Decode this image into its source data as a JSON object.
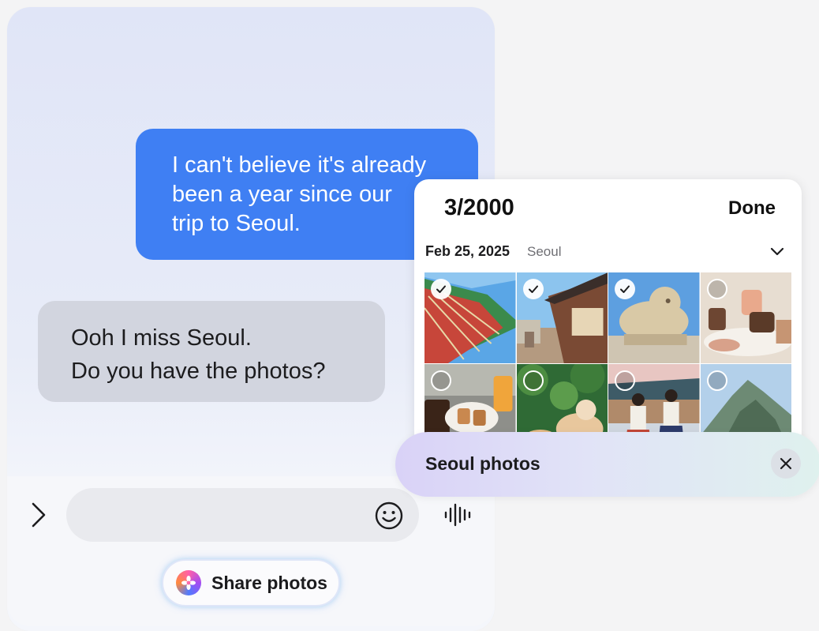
{
  "chat": {
    "outgoing_message": "I can't believe it's already been a year since our trip to Seoul.",
    "outgoing_lines": [
      "I can't believe it's already",
      "been a year since our",
      "trip to Seoul."
    ],
    "incoming_lines": [
      "Ooh I miss Seoul.",
      "Do you have the photos?"
    ]
  },
  "composer": {
    "expand_icon": "chevron-right-icon",
    "emoji_icon": "smiley-icon",
    "voice_icon": "voice-wave-icon",
    "share_chip_label": "Share photos"
  },
  "picker": {
    "count": "3/2000",
    "done_label": "Done",
    "date": "Feb 25, 2025",
    "location": "Seoul",
    "photos": [
      {
        "subject": "palace roof eaves",
        "selected": true
      },
      {
        "subject": "hanok street",
        "selected": true
      },
      {
        "subject": "stone haetae statue",
        "selected": true
      },
      {
        "subject": "desserts on table",
        "selected": false
      },
      {
        "subject": "coffee and bread",
        "selected": false
      },
      {
        "subject": "cat among plants",
        "selected": false
      },
      {
        "subject": "people in hanbok",
        "selected": false
      },
      {
        "subject": "mountain",
        "selected": false
      }
    ]
  },
  "search": {
    "query": "Seoul photos",
    "clear_icon": "close-icon"
  },
  "colors": {
    "outgoing_bubble": "#3f7ff3",
    "incoming_bubble": "#d2d5df"
  }
}
